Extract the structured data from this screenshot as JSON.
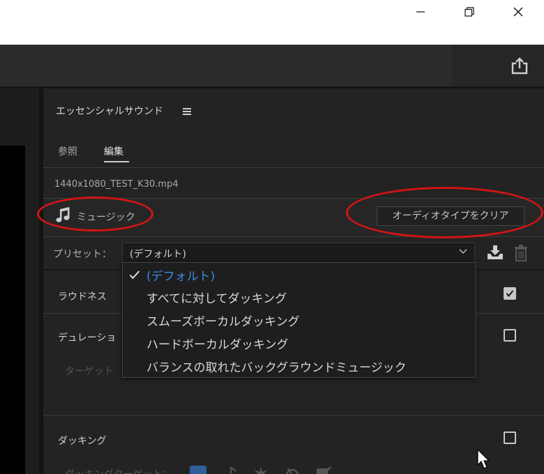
{
  "panel": {
    "title": "エッセンシャルサウンド",
    "tabs": [
      {
        "label": "参照",
        "active": false
      },
      {
        "label": "編集",
        "active": true
      }
    ],
    "filename": "1440x1080_TEST_K30.mp4",
    "audio_type": {
      "label": "ミュージック",
      "icon": "music-note-icon"
    },
    "clear_button": "オーディオタイプをクリア",
    "preset": {
      "label": "プリセット：",
      "value": "(デフォルト)"
    },
    "sections": {
      "loudness": {
        "label": "ラウドネス",
        "checked": true
      },
      "duration": {
        "label": "デュレーショ",
        "checked": false,
        "sub_label": "ターゲット"
      },
      "ducking": {
        "label": "ダッキング",
        "checked": false,
        "sub_label": "ダッキングターゲット："
      }
    }
  },
  "dropdown": {
    "options": [
      {
        "label": "(デフォルト)",
        "selected": true
      },
      {
        "label": "すべてに対してダッキング",
        "selected": false
      },
      {
        "label": "スムーズボーカルダッキング",
        "selected": false
      },
      {
        "label": "ハードボーカルダッキング",
        "selected": false
      },
      {
        "label": "バランスの取れたバックグラウンドミュージック",
        "selected": false
      }
    ]
  },
  "colors": {
    "accent": "#3b8be0",
    "highlight_ellipse": "#d41414",
    "ducking_target_active": "#2e5f99"
  }
}
